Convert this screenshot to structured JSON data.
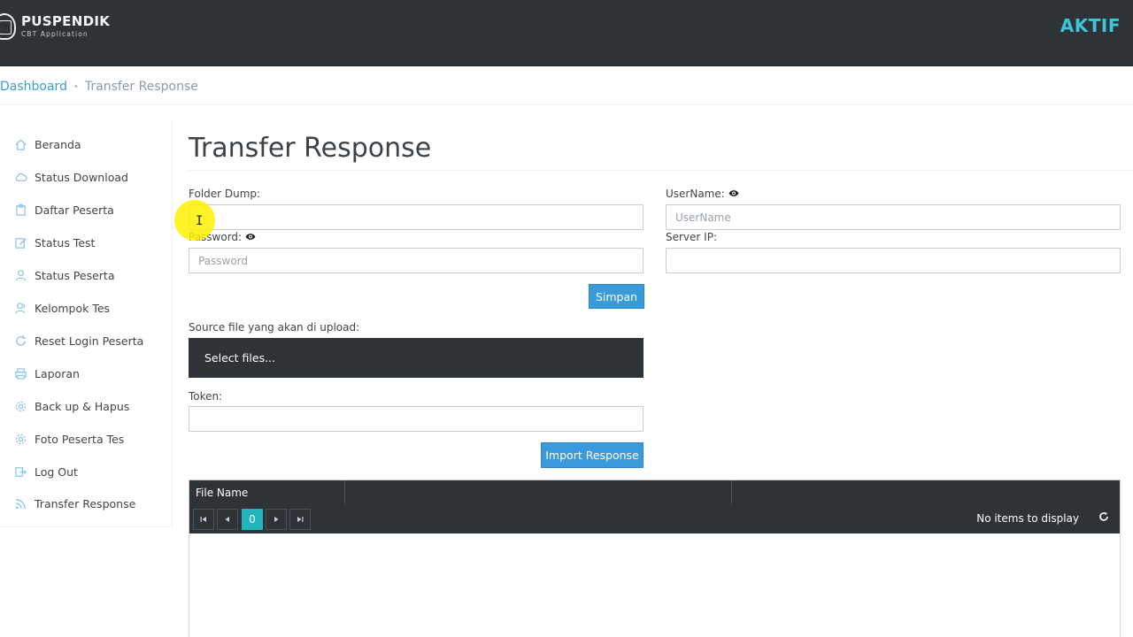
{
  "header": {
    "logo_title": "PUSPENDIK",
    "logo_subtitle": "CBT Application",
    "status": "AKTIF"
  },
  "breadcrumb": {
    "home": "Dashboard",
    "separator": "•",
    "current": "Transfer Response"
  },
  "sidebar": {
    "items": [
      {
        "label": "Beranda",
        "icon": "home-icon"
      },
      {
        "label": "Status Download",
        "icon": "cloud-icon"
      },
      {
        "label": "Daftar Peserta",
        "icon": "clipboard-icon"
      },
      {
        "label": "Status Test",
        "icon": "edit-icon"
      },
      {
        "label": "Status Peserta",
        "icon": "user-icon"
      },
      {
        "label": "Kelompok Tes",
        "icon": "user-group-icon"
      },
      {
        "label": "Reset Login Peserta",
        "icon": "refresh-icon"
      },
      {
        "label": "Laporan",
        "icon": "printer-icon"
      },
      {
        "label": "Back up & Hapus",
        "icon": "gear-icon"
      },
      {
        "label": "Foto Peserta Tes",
        "icon": "gear-icon"
      },
      {
        "label": "Log Out",
        "icon": "logout-icon"
      },
      {
        "label": "Transfer Response",
        "icon": "rss-icon"
      }
    ]
  },
  "main": {
    "title": "Transfer Response",
    "folder_dump": {
      "label": "Folder Dump:",
      "value": ""
    },
    "username": {
      "label": "UserName:",
      "placeholder": "UserName"
    },
    "password": {
      "label": "Password:",
      "placeholder": "Password"
    },
    "server_ip": {
      "label": "Server IP:",
      "value": ""
    },
    "save_button": "Simpan",
    "source_label": "Source file yang akan di upload:",
    "select_files": "Select files...",
    "token": {
      "label": "Token:",
      "value": ""
    },
    "import_button": "Import Response"
  },
  "grid": {
    "columns": [
      "File Name",
      "",
      ""
    ],
    "page": "0",
    "info": "No items to display"
  },
  "colors": {
    "header_bg": "#2e3338",
    "accent": "#3a9bdc",
    "status": "#3ec6d8",
    "page_active": "#22b5bd"
  }
}
